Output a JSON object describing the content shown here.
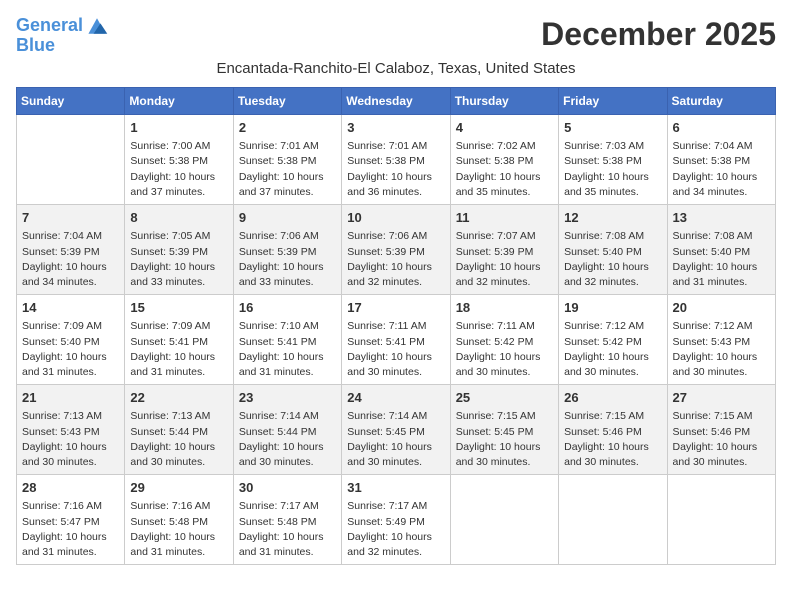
{
  "header": {
    "logo_line1": "General",
    "logo_line2": "Blue",
    "month_title": "December 2025",
    "location": "Encantada-Ranchito-El Calaboz, Texas, United States"
  },
  "weekdays": [
    "Sunday",
    "Monday",
    "Tuesday",
    "Wednesday",
    "Thursday",
    "Friday",
    "Saturday"
  ],
  "weeks": [
    [
      {
        "day": "",
        "content": ""
      },
      {
        "day": "1",
        "content": "Sunrise: 7:00 AM\nSunset: 5:38 PM\nDaylight: 10 hours\nand 37 minutes."
      },
      {
        "day": "2",
        "content": "Sunrise: 7:01 AM\nSunset: 5:38 PM\nDaylight: 10 hours\nand 37 minutes."
      },
      {
        "day": "3",
        "content": "Sunrise: 7:01 AM\nSunset: 5:38 PM\nDaylight: 10 hours\nand 36 minutes."
      },
      {
        "day": "4",
        "content": "Sunrise: 7:02 AM\nSunset: 5:38 PM\nDaylight: 10 hours\nand 35 minutes."
      },
      {
        "day": "5",
        "content": "Sunrise: 7:03 AM\nSunset: 5:38 PM\nDaylight: 10 hours\nand 35 minutes."
      },
      {
        "day": "6",
        "content": "Sunrise: 7:04 AM\nSunset: 5:38 PM\nDaylight: 10 hours\nand 34 minutes."
      }
    ],
    [
      {
        "day": "7",
        "content": "Sunrise: 7:04 AM\nSunset: 5:39 PM\nDaylight: 10 hours\nand 34 minutes."
      },
      {
        "day": "8",
        "content": "Sunrise: 7:05 AM\nSunset: 5:39 PM\nDaylight: 10 hours\nand 33 minutes."
      },
      {
        "day": "9",
        "content": "Sunrise: 7:06 AM\nSunset: 5:39 PM\nDaylight: 10 hours\nand 33 minutes."
      },
      {
        "day": "10",
        "content": "Sunrise: 7:06 AM\nSunset: 5:39 PM\nDaylight: 10 hours\nand 32 minutes."
      },
      {
        "day": "11",
        "content": "Sunrise: 7:07 AM\nSunset: 5:39 PM\nDaylight: 10 hours\nand 32 minutes."
      },
      {
        "day": "12",
        "content": "Sunrise: 7:08 AM\nSunset: 5:40 PM\nDaylight: 10 hours\nand 32 minutes."
      },
      {
        "day": "13",
        "content": "Sunrise: 7:08 AM\nSunset: 5:40 PM\nDaylight: 10 hours\nand 31 minutes."
      }
    ],
    [
      {
        "day": "14",
        "content": "Sunrise: 7:09 AM\nSunset: 5:40 PM\nDaylight: 10 hours\nand 31 minutes."
      },
      {
        "day": "15",
        "content": "Sunrise: 7:09 AM\nSunset: 5:41 PM\nDaylight: 10 hours\nand 31 minutes."
      },
      {
        "day": "16",
        "content": "Sunrise: 7:10 AM\nSunset: 5:41 PM\nDaylight: 10 hours\nand 31 minutes."
      },
      {
        "day": "17",
        "content": "Sunrise: 7:11 AM\nSunset: 5:41 PM\nDaylight: 10 hours\nand 30 minutes."
      },
      {
        "day": "18",
        "content": "Sunrise: 7:11 AM\nSunset: 5:42 PM\nDaylight: 10 hours\nand 30 minutes."
      },
      {
        "day": "19",
        "content": "Sunrise: 7:12 AM\nSunset: 5:42 PM\nDaylight: 10 hours\nand 30 minutes."
      },
      {
        "day": "20",
        "content": "Sunrise: 7:12 AM\nSunset: 5:43 PM\nDaylight: 10 hours\nand 30 minutes."
      }
    ],
    [
      {
        "day": "21",
        "content": "Sunrise: 7:13 AM\nSunset: 5:43 PM\nDaylight: 10 hours\nand 30 minutes."
      },
      {
        "day": "22",
        "content": "Sunrise: 7:13 AM\nSunset: 5:44 PM\nDaylight: 10 hours\nand 30 minutes."
      },
      {
        "day": "23",
        "content": "Sunrise: 7:14 AM\nSunset: 5:44 PM\nDaylight: 10 hours\nand 30 minutes."
      },
      {
        "day": "24",
        "content": "Sunrise: 7:14 AM\nSunset: 5:45 PM\nDaylight: 10 hours\nand 30 minutes."
      },
      {
        "day": "25",
        "content": "Sunrise: 7:15 AM\nSunset: 5:45 PM\nDaylight: 10 hours\nand 30 minutes."
      },
      {
        "day": "26",
        "content": "Sunrise: 7:15 AM\nSunset: 5:46 PM\nDaylight: 10 hours\nand 30 minutes."
      },
      {
        "day": "27",
        "content": "Sunrise: 7:15 AM\nSunset: 5:46 PM\nDaylight: 10 hours\nand 30 minutes."
      }
    ],
    [
      {
        "day": "28",
        "content": "Sunrise: 7:16 AM\nSunset: 5:47 PM\nDaylight: 10 hours\nand 31 minutes."
      },
      {
        "day": "29",
        "content": "Sunrise: 7:16 AM\nSunset: 5:48 PM\nDaylight: 10 hours\nand 31 minutes."
      },
      {
        "day": "30",
        "content": "Sunrise: 7:17 AM\nSunset: 5:48 PM\nDaylight: 10 hours\nand 31 minutes."
      },
      {
        "day": "31",
        "content": "Sunrise: 7:17 AM\nSunset: 5:49 PM\nDaylight: 10 hours\nand 32 minutes."
      },
      {
        "day": "",
        "content": ""
      },
      {
        "day": "",
        "content": ""
      },
      {
        "day": "",
        "content": ""
      }
    ]
  ]
}
